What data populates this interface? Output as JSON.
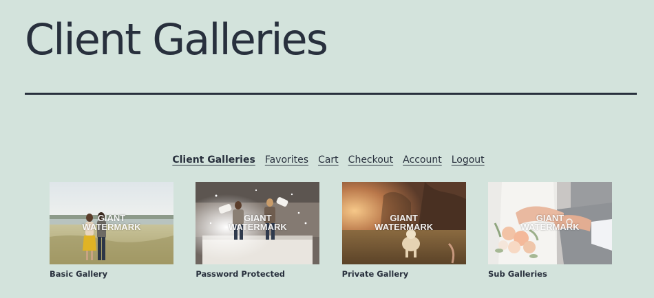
{
  "page": {
    "title": "Client Galleries"
  },
  "nav": {
    "items": [
      {
        "label": "Client Galleries",
        "active": true
      },
      {
        "label": "Favorites",
        "active": false
      },
      {
        "label": "Cart",
        "active": false
      },
      {
        "label": "Checkout",
        "active": false
      },
      {
        "label": "Account",
        "active": false
      },
      {
        "label": "Logout",
        "active": false
      }
    ]
  },
  "galleries": [
    {
      "title": "Basic Gallery",
      "watermark": "GIANT\nWATERMARK"
    },
    {
      "title": "Password Protected",
      "watermark": "GIANT\nWATERMARK"
    },
    {
      "title": "Private Gallery",
      "watermark": "GIANT\nWATERMARK"
    },
    {
      "title": "Sub Galleries",
      "watermark": "GIANT\nWATERMARK"
    }
  ],
  "colors": {
    "background": "#d3e3dc",
    "text": "#28303d"
  }
}
